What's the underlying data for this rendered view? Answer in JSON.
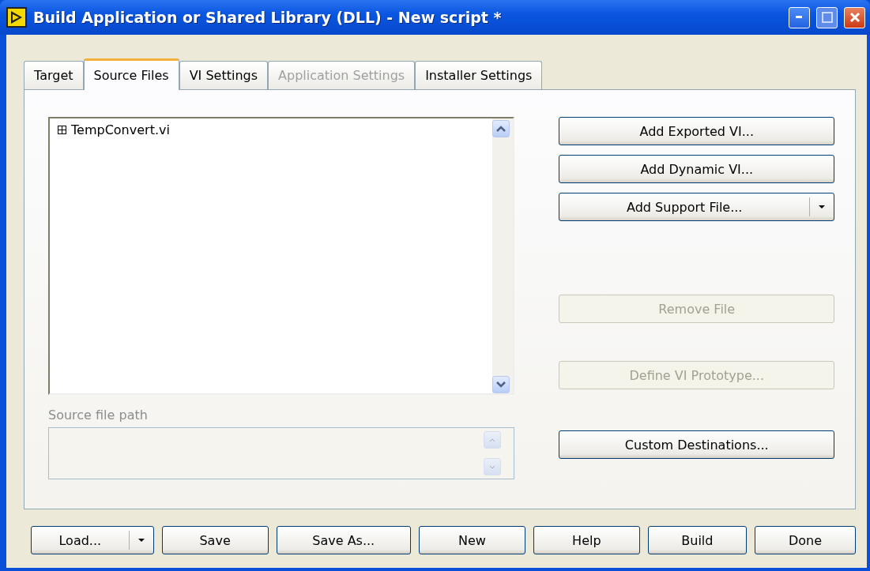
{
  "window": {
    "title": "Build Application or Shared Library (DLL) - New script *"
  },
  "tabs": [
    {
      "label": "Target",
      "selected": false,
      "disabled": false
    },
    {
      "label": "Source Files",
      "selected": true,
      "disabled": false
    },
    {
      "label": "VI Settings",
      "selected": false,
      "disabled": false
    },
    {
      "label": "Application Settings",
      "selected": false,
      "disabled": true
    },
    {
      "label": "Installer Settings",
      "selected": false,
      "disabled": false
    }
  ],
  "source_list": {
    "items": [
      {
        "label": "TempConvert.vi",
        "expanded": false
      }
    ]
  },
  "source_path": {
    "label": "Source file path"
  },
  "actions": [
    {
      "label": "Add Exported VI...",
      "kind": "plain",
      "disabled": false
    },
    {
      "label": "Add Dynamic VI...",
      "kind": "plain",
      "disabled": false
    },
    {
      "label": "Add Support File...",
      "kind": "dropdown",
      "disabled": false
    },
    {
      "label": "Remove File",
      "kind": "plain",
      "disabled": true
    },
    {
      "label": "Define VI Prototype...",
      "kind": "plain",
      "disabled": true
    },
    {
      "label": "Custom Destinations...",
      "kind": "plain",
      "disabled": false
    }
  ],
  "footer_buttons": [
    {
      "label": "Load...",
      "kind": "dropdown"
    },
    {
      "label": "Save",
      "kind": "plain"
    },
    {
      "label": "Save As...",
      "kind": "plain"
    },
    {
      "label": "New",
      "kind": "plain"
    },
    {
      "label": "Help",
      "kind": "plain"
    },
    {
      "label": "Build",
      "kind": "plain"
    },
    {
      "label": "Done",
      "kind": "plain"
    }
  ]
}
